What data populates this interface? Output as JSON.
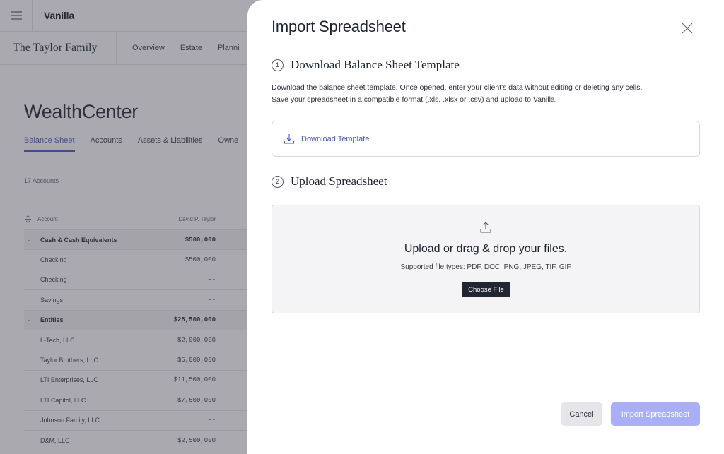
{
  "app": {
    "logo": "Vanilla",
    "client_name": "The Taylor Family",
    "client_nav": [
      "Overview",
      "Estate",
      "Planni"
    ],
    "page_title": "WealthCenter",
    "tabs": [
      {
        "label": "Balance Sheet",
        "active": true
      },
      {
        "label": "Accounts",
        "active": false
      },
      {
        "label": "Assets & Liabilities",
        "active": false
      },
      {
        "label": "Owne",
        "active": false
      }
    ],
    "account_count": "17 Accounts",
    "table": {
      "col_account": "Account",
      "col_owner": "David P. Taylor",
      "rows": [
        {
          "name": "Cash & Cash Equivalents",
          "value": "$500,000",
          "group": true
        },
        {
          "name": "Checking",
          "value": "$500,000",
          "group": false
        },
        {
          "name": "Checking",
          "value": "--",
          "group": false
        },
        {
          "name": "Savings",
          "value": "--",
          "group": false
        },
        {
          "name": "Entities",
          "value": "$28,500,000",
          "group": true
        },
        {
          "name": "L-Tech, LLC",
          "value": "$2,000,000",
          "group": false
        },
        {
          "name": "Taylor Brothers, LLC",
          "value": "$5,000,000",
          "group": false
        },
        {
          "name": "LTI Enterprises, LLC",
          "value": "$11,500,000",
          "group": false
        },
        {
          "name": "LTI Capitol, LLC",
          "value": "$7,500,000",
          "group": false
        },
        {
          "name": "Johnson Family, LLC",
          "value": "--",
          "group": false
        },
        {
          "name": "D&M, LLC",
          "value": "$2,500,000",
          "group": false
        }
      ]
    }
  },
  "drawer": {
    "title": "Import Spreadsheet",
    "step1": {
      "number": "1",
      "title": "Download Balance Sheet Template",
      "description_line1": "Download the balance sheet template. Once opened, enter your client's data without editing or deleting any cells.",
      "description_line2": "Save your spreadsheet in a compatible format (.xls, .xlsx or .csv) and upload to Vanilla.",
      "download_label": "Download Template"
    },
    "step2": {
      "number": "2",
      "title": "Upload Spreadsheet",
      "drop_title": "Upload or drag & drop your files.",
      "drop_subtitle": "Supported file types: PDF, DOC, PNG, JPEG, TIF, GIF",
      "choose_label": "Choose File"
    },
    "cancel_label": "Cancel",
    "import_label": "Import Spreadsheet"
  },
  "colors": {
    "accent": "#4a55c8",
    "import_button": "#a9aef5",
    "choose_button": "#222532"
  },
  "icons": {
    "menu": "hamburger-icon",
    "close": "close-icon",
    "download": "download-icon",
    "upload": "upload-icon",
    "sort": "sort-icon"
  }
}
